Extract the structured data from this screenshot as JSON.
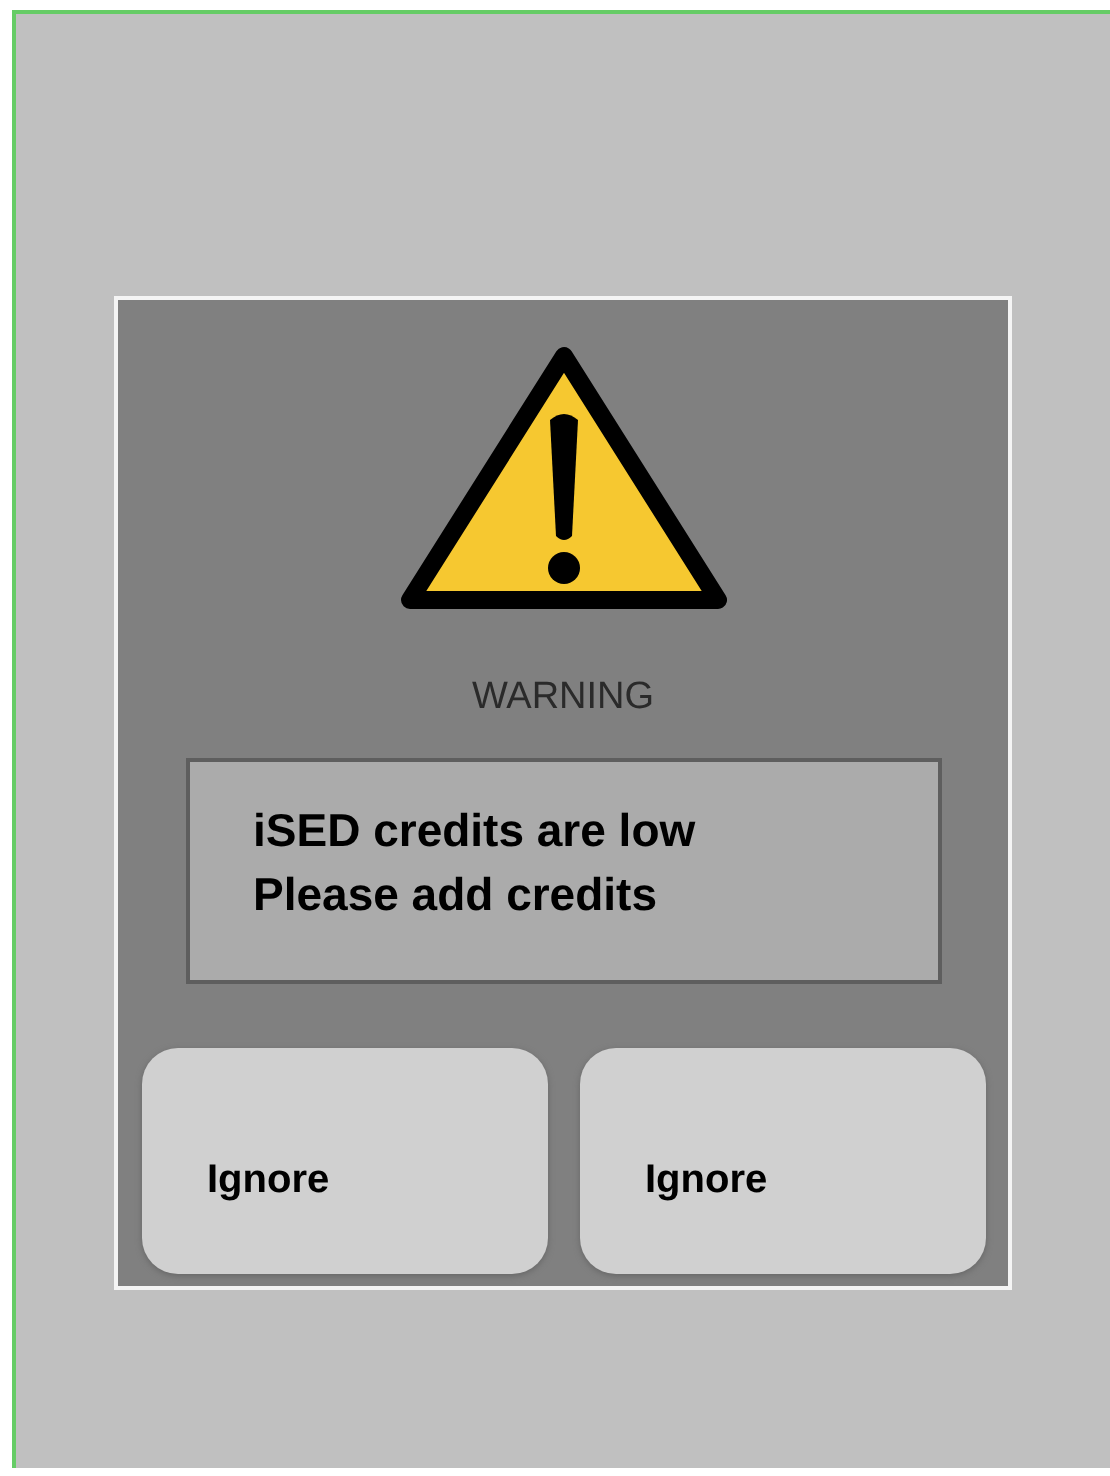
{
  "dialog": {
    "heading": "WARNING",
    "message_lines": [
      "iSED credits are low",
      "Please add credits"
    ],
    "buttons": [
      {
        "label": "Ignore"
      },
      {
        "label": "Ignore"
      }
    ]
  }
}
